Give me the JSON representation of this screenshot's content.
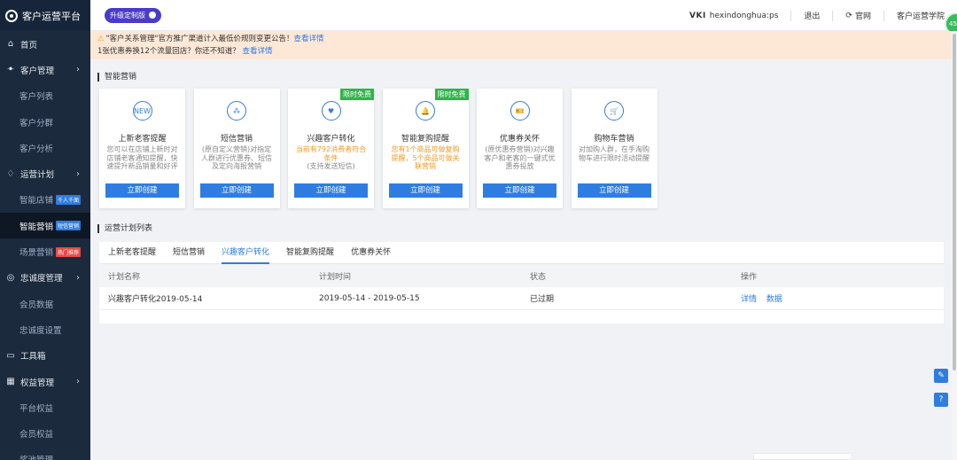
{
  "brand": {
    "title": "客户运营平台",
    "icon": "logo-icon"
  },
  "sidebar": {
    "items": [
      {
        "label": "首页",
        "icon": "home-icon",
        "type": "top"
      },
      {
        "label": "客户管理",
        "icon": "users-icon",
        "type": "group",
        "arrow": "›"
      },
      {
        "label": "客户列表",
        "type": "sub"
      },
      {
        "label": "客户分群",
        "type": "sub"
      },
      {
        "label": "客户分析",
        "type": "sub"
      },
      {
        "label": "运营计划",
        "icon": "bulb-icon",
        "type": "group",
        "arrow": "›"
      },
      {
        "label": "智能店铺",
        "type": "sub",
        "tag": "千人千面",
        "tagColor": "blue"
      },
      {
        "label": "智能营销",
        "type": "sub",
        "tag": "短信营销",
        "tagColor": "blue",
        "active": true
      },
      {
        "label": "场景营销",
        "type": "sub",
        "tag": "热门推荐",
        "tagColor": "red"
      },
      {
        "label": "忠诚度管理",
        "icon": "loyalty-icon",
        "type": "group",
        "arrow": "›"
      },
      {
        "label": "会员数据",
        "type": "sub"
      },
      {
        "label": "忠诚度设置",
        "type": "sub"
      },
      {
        "label": "工具箱",
        "icon": "toolbox-icon",
        "type": "top"
      },
      {
        "label": "权益管理",
        "icon": "gift-icon",
        "type": "group",
        "arrow": "›"
      },
      {
        "label": "平台权益",
        "type": "sub"
      },
      {
        "label": "会员权益",
        "type": "sub"
      },
      {
        "label": "奖池管理",
        "type": "sub"
      }
    ]
  },
  "topbar": {
    "upgrade_label": "升级定制版",
    "brand_mark": "VKI",
    "username": "hexindonghua:ps",
    "logout": "退出",
    "official_site": "官网",
    "academy": "客户运营学院",
    "badge": "45"
  },
  "notice": {
    "line1": "\"客户关系管理\"官方推广渠道计入最低价规则变更公告！",
    "line1_link": "查看详情",
    "line2": "1张优惠券换12个流量回店？你还不知道？",
    "line2_link": "查看详情"
  },
  "smart_marketing": {
    "title": "智能营销",
    "cards": [
      {
        "title": "上新老客提醒",
        "desc": "您可以在店铺上新时对店铺老客通知提醒，快速提升新品销量和好评",
        "button": "立即创建",
        "icon_text": "NEW",
        "icon": "new-icon"
      },
      {
        "title": "短信营销",
        "desc": "(原自定义营销)对指定人群进行优惠券、短信及定向海报营销",
        "button": "立即创建",
        "icon_text": "⁂",
        "icon": "sms-icon"
      },
      {
        "title": "兴趣客户转化",
        "desc": "当前有792消费者符合条件",
        "desc2": "(支持发送短信)",
        "button": "立即创建",
        "ribbon": "限时免费",
        "icon_text": "♥",
        "icon": "heart-icon",
        "highlight": true
      },
      {
        "title": "智能复购提醒",
        "desc": "您有1个商品可做复购提醒，5个商品可做关联营销",
        "button": "立即创建",
        "ribbon": "限时免费",
        "icon_text": "🔔",
        "icon": "bell-icon",
        "highlight": true
      },
      {
        "title": "优惠券关怀",
        "desc": "(原优惠券营销)对兴趣客户和老客的一键式优惠券投放",
        "button": "立即创建",
        "icon_text": "🎫",
        "icon": "coupon-icon"
      },
      {
        "title": "购物车营销",
        "desc": "对加购人群，在手淘购物车进行限时活动提醒",
        "button": "立即创建",
        "icon_text": "🛒",
        "icon": "cart-icon"
      }
    ]
  },
  "plan_list": {
    "title": "运营计划列表",
    "tabs": [
      "上新老客提醒",
      "短信营销",
      "兴趣客户转化",
      "智能复购提醒",
      "优惠券关怀"
    ],
    "active_tab": 2,
    "columns": [
      "计划名称",
      "计划时间",
      "状态",
      "操作"
    ],
    "rows": [
      {
        "name": "兴趣客户转化2019-05-14",
        "time": "2019-05-14 - 2019-05-15",
        "status": "已过期",
        "actions": [
          "详情",
          "数据"
        ]
      }
    ]
  },
  "float_buttons": [
    {
      "icon": "edit-icon",
      "glyph": "✎"
    },
    {
      "icon": "help-icon",
      "glyph": "?"
    }
  ],
  "colors": {
    "accent": "#2f7de1",
    "sidebar": "#1b2a3d",
    "ribbon": "#2fb44a",
    "highlight": "#f49a2a"
  }
}
